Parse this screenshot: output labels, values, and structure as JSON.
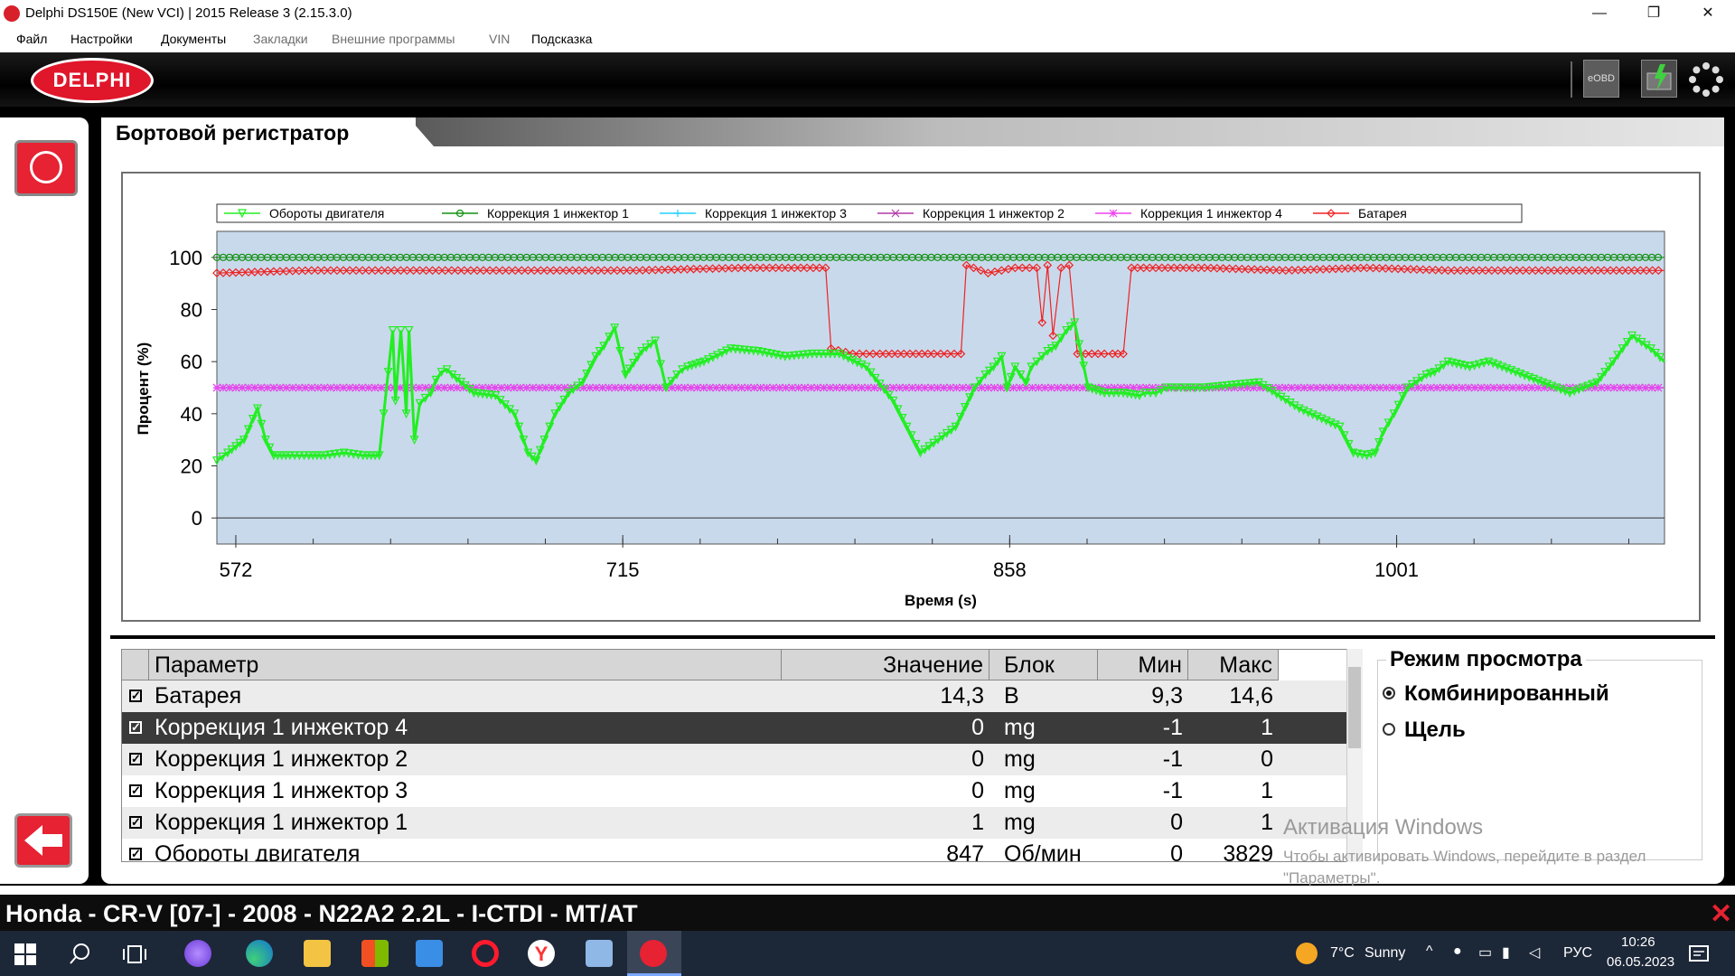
{
  "window": {
    "title": "Delphi DS150E (New VCI) | 2015 Release 3 (2.15.3.0)",
    "controls": {
      "minimize": "—",
      "restore": "❐",
      "close": "✕"
    }
  },
  "menu": [
    {
      "label": "Файл",
      "enabled": true
    },
    {
      "label": "Настройки",
      "enabled": true
    },
    {
      "label": "Документы",
      "enabled": true
    },
    {
      "label": "Закладки",
      "enabled": false
    },
    {
      "label": "Внешние программы",
      "enabled": false
    },
    {
      "label": "VIN",
      "enabled": false
    },
    {
      "label": "Подсказка",
      "enabled": true
    }
  ],
  "header": {
    "logo": "DELPHI",
    "eobd": "eOBD"
  },
  "page": {
    "title": "Бортовой регистратор"
  },
  "chart_data": {
    "type": "line",
    "xlabel": "Время (s)",
    "ylabel": "Процент (%)",
    "xlim": [
      565,
      1100
    ],
    "ylim": [
      -10,
      110
    ],
    "x_ticks": [
      572,
      715,
      858,
      1001
    ],
    "y_ticks": [
      0,
      20,
      40,
      60,
      80,
      100
    ],
    "grid": false,
    "legend_position": "top",
    "series": [
      {
        "name": "Обороты двигателя",
        "color": "#22ee22",
        "marker": "triangle-down",
        "x": [
          565,
          569,
          575,
          580,
          583,
          586,
          589,
          592,
          599,
          605,
          612,
          619,
          625,
          630,
          631,
          633,
          635,
          636,
          638,
          640,
          644,
          646,
          648,
          650,
          652,
          660,
          668,
          675,
          680,
          683,
          686,
          690,
          695,
          700,
          705,
          708,
          712,
          716,
          722,
          727,
          731,
          735,
          737,
          739,
          745,
          755,
          765,
          775,
          785,
          795,
          805,
          815,
          825,
          838,
          845,
          849,
          852,
          855,
          857,
          860,
          864,
          866,
          870,
          872,
          875,
          879,
          882,
          887,
          893,
          900,
          906,
          908,
          912,
          916,
          930,
          950,
          965,
          980,
          985,
          990,
          993,
          996,
          1000,
          1005,
          1012,
          1015,
          1020,
          1028,
          1035,
          1045,
          1055,
          1065,
          1075,
          1081,
          1088,
          1095,
          1100
        ],
        "y": [
          22,
          25,
          30,
          42,
          30,
          24,
          24,
          24,
          24,
          24,
          25,
          24,
          24,
          72,
          45,
          72,
          40,
          72,
          30,
          44,
          48,
          53,
          56,
          57,
          55,
          48,
          47,
          40,
          25,
          22,
          30,
          40,
          48,
          52,
          62,
          66,
          73,
          55,
          64,
          68,
          50,
          55,
          57,
          58,
          60,
          65,
          64,
          62,
          63,
          63,
          58,
          45,
          25,
          35,
          50,
          55,
          58,
          62,
          50,
          58,
          52,
          58,
          62,
          64,
          66,
          72,
          75,
          50,
          48,
          48,
          47,
          48,
          48,
          50,
          50,
          52,
          42,
          35,
          25,
          24,
          25,
          33,
          40,
          50,
          55,
          56,
          60,
          58,
          60,
          56,
          52,
          48,
          52,
          60,
          70,
          65,
          60
        ]
      },
      {
        "name": "Коррекция 1 инжектор 1",
        "color": "#109010",
        "marker": "circle",
        "x": [
          565,
          1100
        ],
        "y": [
          100,
          100
        ]
      },
      {
        "name": "Коррекция 1 инжектор 3",
        "color": "#20d0ff",
        "marker": "plus",
        "x": [
          565,
          1100
        ],
        "y": [
          50,
          50
        ]
      },
      {
        "name": "Коррекция 1 инжектор 2",
        "color": "#b03aa8",
        "marker": "x",
        "x": [
          565,
          1100
        ],
        "y": [
          50,
          50
        ]
      },
      {
        "name": "Коррекция 1 инжектор 4",
        "color": "#ee44ee",
        "marker": "asterisk",
        "x": [
          565,
          1100
        ],
        "y": [
          50,
          50
        ]
      },
      {
        "name": "Батарея",
        "color": "#ee2222",
        "marker": "diamond",
        "x": [
          565,
          600,
          640,
          680,
          720,
          760,
          790,
          792,
          800,
          810,
          830,
          840,
          842,
          850,
          860,
          868,
          870,
          872,
          874,
          877,
          880,
          883,
          886,
          893,
          896,
          900,
          903,
          930,
          960,
          990,
          1020,
          1050,
          1080,
          1100
        ],
        "y": [
          94,
          95,
          95,
          95,
          95,
          96,
          96,
          65,
          63,
          63,
          63,
          63,
          97,
          94,
          96,
          96,
          75,
          97,
          70,
          96,
          97,
          63,
          63,
          63,
          63,
          63,
          96,
          96,
          95,
          96,
          95,
          95,
          95,
          95
        ]
      }
    ]
  },
  "table": {
    "columns": [
      "Параметр",
      "Значение",
      "Блок",
      "Мин",
      "Макс"
    ],
    "rows": [
      {
        "name": "Батарея",
        "value": "14,3",
        "unit": "В",
        "min": "9,3",
        "max": "14,6",
        "checked": true,
        "selected": false
      },
      {
        "name": "Коррекция 1 инжектор 4",
        "value": "0",
        "unit": "mg",
        "min": "-1",
        "max": "1",
        "checked": true,
        "selected": true
      },
      {
        "name": "Коррекция 1 инжектор 2",
        "value": "0",
        "unit": "mg",
        "min": "-1",
        "max": "0",
        "checked": true,
        "selected": false
      },
      {
        "name": "Коррекция 1 инжектор 3",
        "value": "0",
        "unit": "mg",
        "min": "-1",
        "max": "1",
        "checked": true,
        "selected": false
      },
      {
        "name": "Коррекция 1 инжектор 1",
        "value": "1",
        "unit": "mg",
        "min": "0",
        "max": "1",
        "checked": true,
        "selected": false
      },
      {
        "name": "Обороты двигателя",
        "value": "847",
        "unit": "Об/мин",
        "min": "0",
        "max": "3829",
        "checked": true,
        "selected": false
      }
    ]
  },
  "view_mode": {
    "title": "Режим просмотра",
    "options": [
      {
        "label": "Комбинированный",
        "selected": true
      },
      {
        "label": "Щель",
        "selected": false
      }
    ]
  },
  "watermark": {
    "line1": "Активация Windows",
    "line2": "Чтобы активировать Windows, перейдите в раздел",
    "line3": "\"Параметры\"."
  },
  "vehicle": "Honda - CR-V [07-] - 2008 - N22A2 2.2L - I-CTDI - MT/AT",
  "taskbar": {
    "weather_temp": "7°C",
    "weather_text": "Sunny",
    "lang": "РУС",
    "time": "10:26",
    "date": "06.05.2023"
  },
  "colors": {
    "accent": "#e62233",
    "plot_bg": "#c9d9ec",
    "selected_row": "#3a3a3a"
  }
}
